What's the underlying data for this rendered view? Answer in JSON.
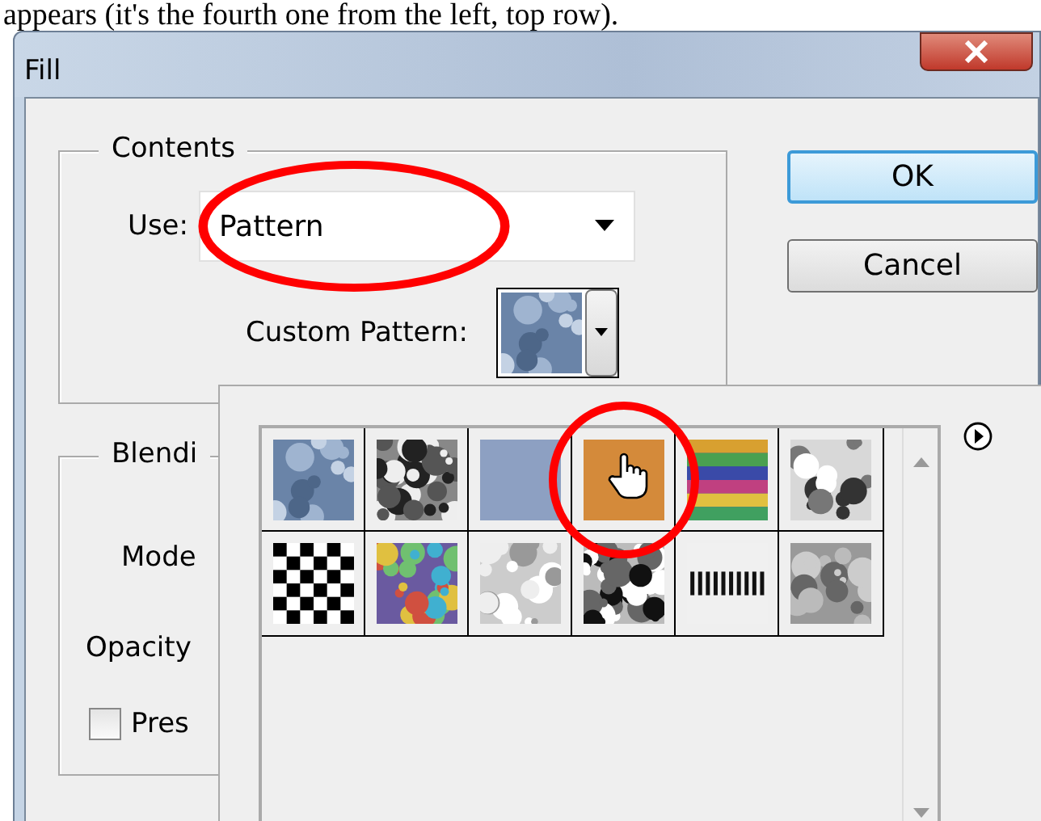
{
  "caption": "appears (it's the fourth one from the left, top row).",
  "window": {
    "title": "Fill"
  },
  "contents": {
    "label": "Contents",
    "use_label": "Use:",
    "use_value": "Pattern",
    "use_circled": true,
    "custom_pattern_label": "Custom Pattern:"
  },
  "buttons": [
    {
      "label": "OK",
      "default": true
    },
    {
      "label": "Cancel",
      "default": false
    }
  ],
  "blending": {
    "label": "Blendi",
    "mode_label": "Mode",
    "opacity_label": "Opacity",
    "preserve": {
      "label": "Pres",
      "checked": false
    }
  },
  "patterns": [
    {
      "kind": "bubbles",
      "circled": false,
      "hovered": false
    },
    {
      "kind": "noise",
      "circled": false,
      "hovered": false
    },
    {
      "kind": "plain",
      "circled": false,
      "hovered": false
    },
    {
      "kind": "orange",
      "circled": true,
      "hovered": true
    },
    {
      "kind": "rainbow",
      "circled": false,
      "hovered": false
    },
    {
      "kind": "marble",
      "circled": false,
      "hovered": false
    },
    {
      "kind": "checker",
      "circled": false,
      "hovered": false
    },
    {
      "kind": "confetti",
      "circled": false,
      "hovered": false
    },
    {
      "kind": "clouds",
      "circled": false,
      "hovered": false
    },
    {
      "kind": "speckle",
      "circled": false,
      "hovered": false
    },
    {
      "kind": "stripes",
      "circled": false,
      "hovered": false
    },
    {
      "kind": "fog",
      "circled": false,
      "hovered": false
    }
  ]
}
